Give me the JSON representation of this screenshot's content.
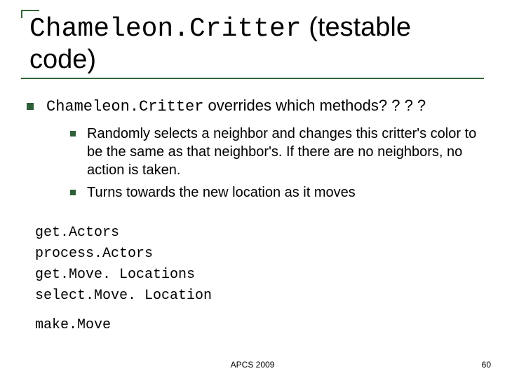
{
  "title": {
    "code": "Chameleon.Critter",
    "rest": " (testable code)"
  },
  "question": {
    "code": "Chameleon.Critter",
    "rest": " overrides which methods? ? ? ?"
  },
  "subpoints": [
    "Randomly selects a neighbor and changes this critter's color to be the same as that neighbor's. If there are no neighbors, no action is taken.",
    "Turns towards the new location as it moves"
  ],
  "methods_block1": [
    "get.Actors",
    "process.Actors",
    "get.Move. Locations",
    "select.Move. Location"
  ],
  "methods_block2": [
    "make.Move"
  ],
  "footer_center": "APCS 2009",
  "page_number": "60"
}
